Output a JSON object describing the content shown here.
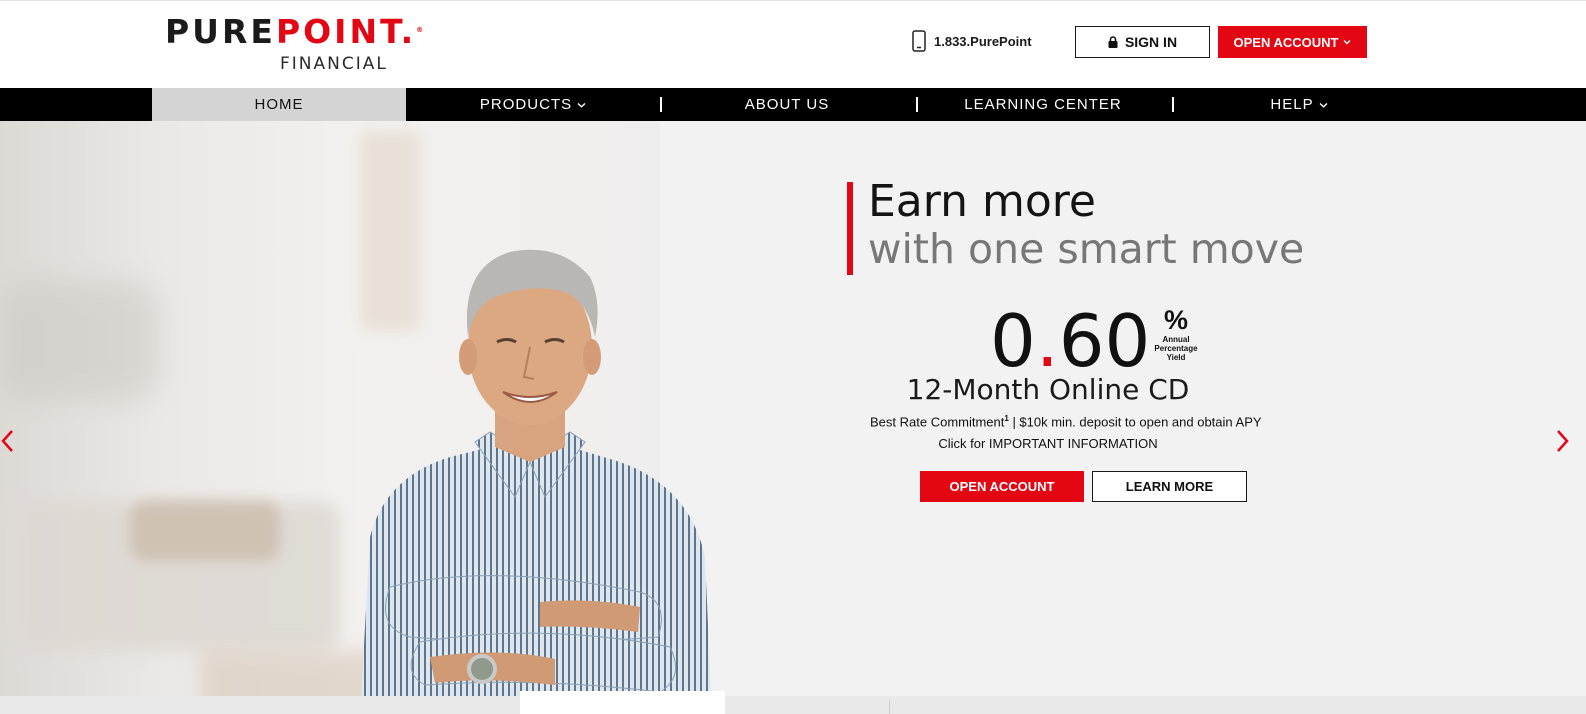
{
  "header": {
    "logo": {
      "word_dark": "PURE",
      "word_red": "POINT",
      "dot": ".",
      "reg": "®",
      "sub": "FINANCIAL"
    },
    "phone": "1.833.PurePoint",
    "signin_label": "SIGN IN",
    "open_account_label": "OPEN ACCOUNT",
    "icons": {
      "phone": "phone-icon",
      "signin": "lock-icon",
      "open_account": "chevron-down-icon"
    }
  },
  "nav": {
    "items": [
      {
        "label": "HOME",
        "active": true,
        "dropdown": false
      },
      {
        "label": "PRODUCTS",
        "active": false,
        "dropdown": true
      },
      {
        "label": "ABOUT US",
        "active": false,
        "dropdown": false
      },
      {
        "label": "LEARNING CENTER",
        "active": false,
        "dropdown": false
      },
      {
        "label": "HELP",
        "active": false,
        "dropdown": true
      }
    ]
  },
  "hero": {
    "headline_1": "Earn more",
    "headline_2": "with one smart move",
    "rate_int": "0",
    "rate_dot": ".",
    "rate_dec": "60",
    "pct_sign": "%",
    "pct_label_1": "Annual",
    "pct_label_2": "Percentage",
    "pct_label_3": "Yield",
    "product": "12-Month Online CD",
    "disclaimer_a": "Best Rate Commitment",
    "disclaimer_sup": "1",
    "disclaimer_b": " | $10k min. deposit to open and obtain APY",
    "info_link": "Click for IMPORTANT INFORMATION",
    "open_account_label": "OPEN ACCOUNT",
    "learn_more_label": "LEARN MORE",
    "carousel_icons": {
      "prev": "chevron-left-icon",
      "next": "chevron-right-icon"
    }
  },
  "colors": {
    "brand_red": "#e30613",
    "nav_bg": "#000000",
    "nav_active_bg": "#d4d4d4",
    "hero_bg": "#f2f2f3"
  }
}
